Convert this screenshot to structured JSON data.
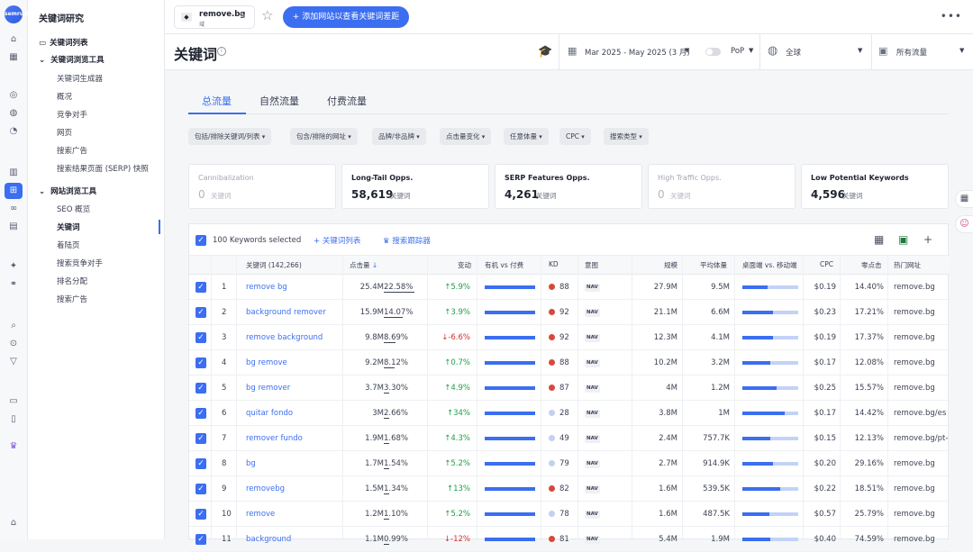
{
  "rail": {
    "logo_text": "semrush"
  },
  "sidebar": {
    "title": "关键词研究",
    "items": [
      {
        "label": "关键词列表",
        "level": 1
      },
      {
        "label": "关键词浏览工具",
        "level": 1
      },
      {
        "label": "关键词生成器",
        "level": 2
      },
      {
        "label": "概况",
        "level": 2
      },
      {
        "label": "竞争对手",
        "level": 2
      },
      {
        "label": "网页",
        "level": 2
      },
      {
        "label": "搜索广告",
        "level": 2
      },
      {
        "label": "搜索结果页面 (SERP) 快照",
        "level": 2
      },
      {
        "label": "网站浏览工具",
        "level": 1
      },
      {
        "label": "SEO 概览",
        "level": 2
      },
      {
        "label": "关键词",
        "level": 2
      },
      {
        "label": "着陆页",
        "level": 2
      },
      {
        "label": "搜索竞争对手",
        "level": 2
      },
      {
        "label": "排名分配",
        "level": 2
      },
      {
        "label": "搜索广告",
        "level": 2
      }
    ]
  },
  "topbar": {
    "domain": "remove.bg",
    "domain_type": "域",
    "add_button": "+ 添加网站以查看关键词差距",
    "more": "•••"
  },
  "header": {
    "title": "关键词",
    "info": "i",
    "date_range": "Mar 2025 - May 2025 (3 月)",
    "pop": "PoP",
    "region": "全球",
    "traffic": "所有流量"
  },
  "tabs": [
    "总流量",
    "自然流量",
    "付费流量"
  ],
  "filters": [
    "包括/排除关键词/列表",
    "包含/排除的网址",
    "品牌/非品牌",
    "点击量变化",
    "任意体量",
    "CPC",
    "搜索类型"
  ],
  "cards": [
    {
      "title": "Cannibalization",
      "value": "0",
      "unit": "关键词"
    },
    {
      "title": "Long-Tail Opps.",
      "value": "58,619",
      "unit": "关键词"
    },
    {
      "title": "SERP Features Opps.",
      "value": "4,261",
      "unit": "关键词"
    },
    {
      "title": "High Traffic Opps.",
      "value": "0",
      "unit": "关键词"
    },
    {
      "title": "Low Potential Keywords",
      "value": "4,596",
      "unit": "关键词"
    }
  ],
  "table": {
    "selected": "100 Keywords selected",
    "action_list": "+ 关键词列表",
    "action_tracker": "搜索跟踪器",
    "headers": {
      "keyword": "关键词 (142,266)",
      "clicks": "点击量",
      "change": "变动",
      "organic_vs_paid": "有机 vs 付费",
      "kd": "KD",
      "intent": "意图",
      "volume": "规模",
      "avg_volume": "平均体量",
      "desktop_vs_mobile": "桌面端 vs. 移动端",
      "cpc": "CPC",
      "zero_click": "零点击",
      "top_url": "热门网址"
    },
    "rows": [
      {
        "n": "1",
        "kw": "remove bg",
        "clicks": "25.4M",
        "share": "22.58%",
        "change": "5.9%",
        "dir": "up",
        "kd": "88",
        "kdc": "#d9483b",
        "intent": "NAV",
        "vol": "27.9M",
        "avg": "9.5M",
        "desk": 0.45,
        "cpc": "$0.19",
        "zero": "14.40%",
        "url": "remove.bg"
      },
      {
        "n": "2",
        "kw": "background remover",
        "clicks": "15.9M",
        "share": "14.07%",
        "change": "3.9%",
        "dir": "up",
        "kd": "92",
        "kdc": "#d9483b",
        "intent": "NAV",
        "vol": "21.1M",
        "avg": "6.6M",
        "desk": 0.55,
        "cpc": "$0.23",
        "zero": "17.21%",
        "url": "remove.bg"
      },
      {
        "n": "3",
        "kw": "remove background",
        "clicks": "9.8M",
        "share": "8.69%",
        "change": "-6.6%",
        "dir": "dn",
        "kd": "92",
        "kdc": "#d9483b",
        "intent": "NAV",
        "vol": "12.3M",
        "avg": "4.1M",
        "desk": 0.55,
        "cpc": "$0.19",
        "zero": "17.37%",
        "url": "remove.bg"
      },
      {
        "n": "4",
        "kw": "bg remove",
        "clicks": "9.2M",
        "share": "8.12%",
        "change": "0.7%",
        "dir": "up",
        "kd": "88",
        "kdc": "#d9483b",
        "intent": "NAV",
        "vol": "10.2M",
        "avg": "3.2M",
        "desk": 0.5,
        "cpc": "$0.17",
        "zero": "12.08%",
        "url": "remove.bg"
      },
      {
        "n": "5",
        "kw": "bg remover",
        "clicks": "3.7M",
        "share": "3.30%",
        "change": "4.9%",
        "dir": "up",
        "kd": "87",
        "kdc": "#d9483b",
        "intent": "NAV",
        "vol": "4M",
        "avg": "1.2M",
        "desk": 0.62,
        "cpc": "$0.25",
        "zero": "15.57%",
        "url": "remove.bg"
      },
      {
        "n": "6",
        "kw": "quitar fondo",
        "clicks": "3M",
        "share": "2.66%",
        "change": "34%",
        "dir": "up",
        "kd": "28",
        "kdc": "#c3d0f0",
        "intent": "NAV",
        "vol": "3.8M",
        "avg": "1M",
        "desk": 0.75,
        "cpc": "$0.17",
        "zero": "14.42%",
        "url": "remove.bg/es"
      },
      {
        "n": "7",
        "kw": "remover fundo",
        "clicks": "1.9M",
        "share": "1.68%",
        "change": "4.3%",
        "dir": "up",
        "kd": "49",
        "kdc": "#c3d0f0",
        "intent": "NAV",
        "vol": "2.4M",
        "avg": "757.7K",
        "desk": 0.5,
        "cpc": "$0.15",
        "zero": "12.13%",
        "url": "remove.bg/pt-br"
      },
      {
        "n": "8",
        "kw": "bg",
        "clicks": "1.7M",
        "share": "1.54%",
        "change": "5.2%",
        "dir": "up",
        "kd": "79",
        "kdc": "#c3d0f0",
        "intent": "NAV",
        "vol": "2.7M",
        "avg": "914.9K",
        "desk": 0.55,
        "cpc": "$0.20",
        "zero": "29.16%",
        "url": "remove.bg"
      },
      {
        "n": "9",
        "kw": "removebg",
        "clicks": "1.5M",
        "share": "1.34%",
        "change": "13%",
        "dir": "up",
        "kd": "82",
        "kdc": "#d9483b",
        "intent": "NAV",
        "vol": "1.6M",
        "avg": "539.5K",
        "desk": 0.68,
        "cpc": "$0.22",
        "zero": "18.51%",
        "url": "remove.bg"
      },
      {
        "n": "10",
        "kw": "remove",
        "clicks": "1.2M",
        "share": "1.10%",
        "change": "5.2%",
        "dir": "up",
        "kd": "78",
        "kdc": "#c3d0f0",
        "intent": "NAV",
        "vol": "1.6M",
        "avg": "487.5K",
        "desk": 0.48,
        "cpc": "$0.57",
        "zero": "25.79%",
        "url": "remove.bg"
      },
      {
        "n": "11",
        "kw": "background",
        "clicks": "1.1M",
        "share": "0.99%",
        "change": "-12%",
        "dir": "dn",
        "kd": "81",
        "kdc": "#d9483b",
        "intent": "NAV",
        "vol": "5.4M",
        "avg": "1.9M",
        "desk": 0.5,
        "cpc": "$0.40",
        "zero": "74.59%",
        "url": "remove.bg"
      }
    ]
  }
}
